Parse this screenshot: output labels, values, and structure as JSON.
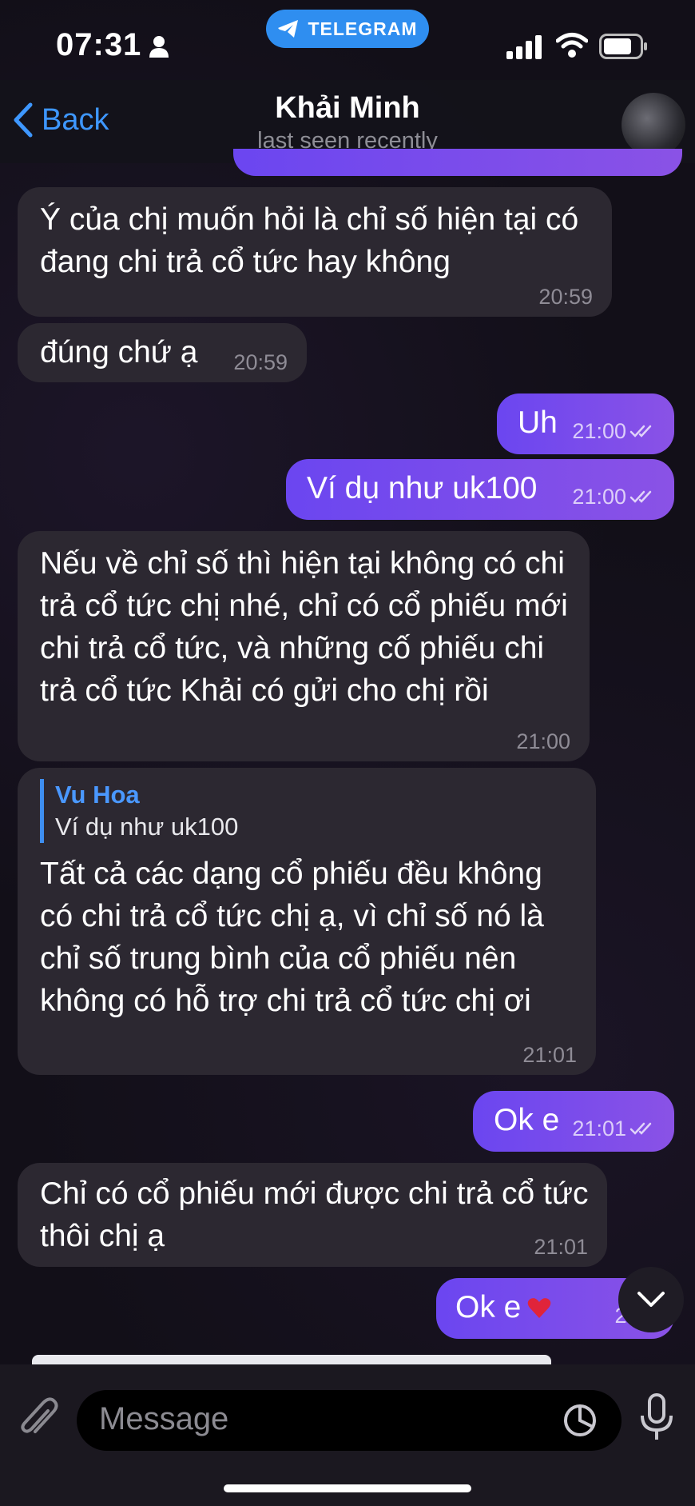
{
  "status_bar": {
    "time": "07:31",
    "app_pill": "TELEGRAM"
  },
  "header": {
    "back_label": "Back",
    "title": "Khải Minh",
    "subtitle": "last seen recently"
  },
  "messages": [
    {
      "dir": "in",
      "text": "Ý của chị muốn hỏi là chỉ số hiện tại có đang chi trả cổ tức hay không",
      "time": "20:59"
    },
    {
      "dir": "in",
      "text": "đúng chứ ạ",
      "time": "20:59"
    },
    {
      "dir": "out",
      "text": "Uh",
      "time": "21:00"
    },
    {
      "dir": "out",
      "text": "Ví dụ như uk100",
      "time": "21:00"
    },
    {
      "dir": "in",
      "text": "Nếu về chỉ số thì hiện tại không có chi trả cổ tức chị nhé, chỉ có cổ phiếu mới chi trả cổ tức, và những cố phiếu chi trả cổ tức Khải có gửi cho chị rồi",
      "time": "21:00"
    },
    {
      "dir": "in",
      "reply_name": "Vu Hoa",
      "reply_text": "Ví dụ như uk100",
      "text": "Tất cả các dạng cổ phiếu đều không có chi trả cổ tức chị ạ, vì chỉ số nó là chỉ số trung bình của cổ phiếu nên không có hỗ trợ chi trả cổ tức chị ơi",
      "time": "21:01"
    },
    {
      "dir": "out",
      "text": "Ok e",
      "time": "21:01"
    },
    {
      "dir": "in",
      "text": "Chỉ có cổ phiếu mới được chi trả cổ tức thôi chị ạ",
      "time": "21:01"
    },
    {
      "dir": "out",
      "text": "Ok e",
      "time": "21:0"
    }
  ],
  "input": {
    "placeholder": "Message"
  },
  "colors": {
    "accent": "#3e97ff",
    "outgoing": "#7a4cec",
    "incoming": "#2c2831",
    "heart": "#e0243a"
  }
}
